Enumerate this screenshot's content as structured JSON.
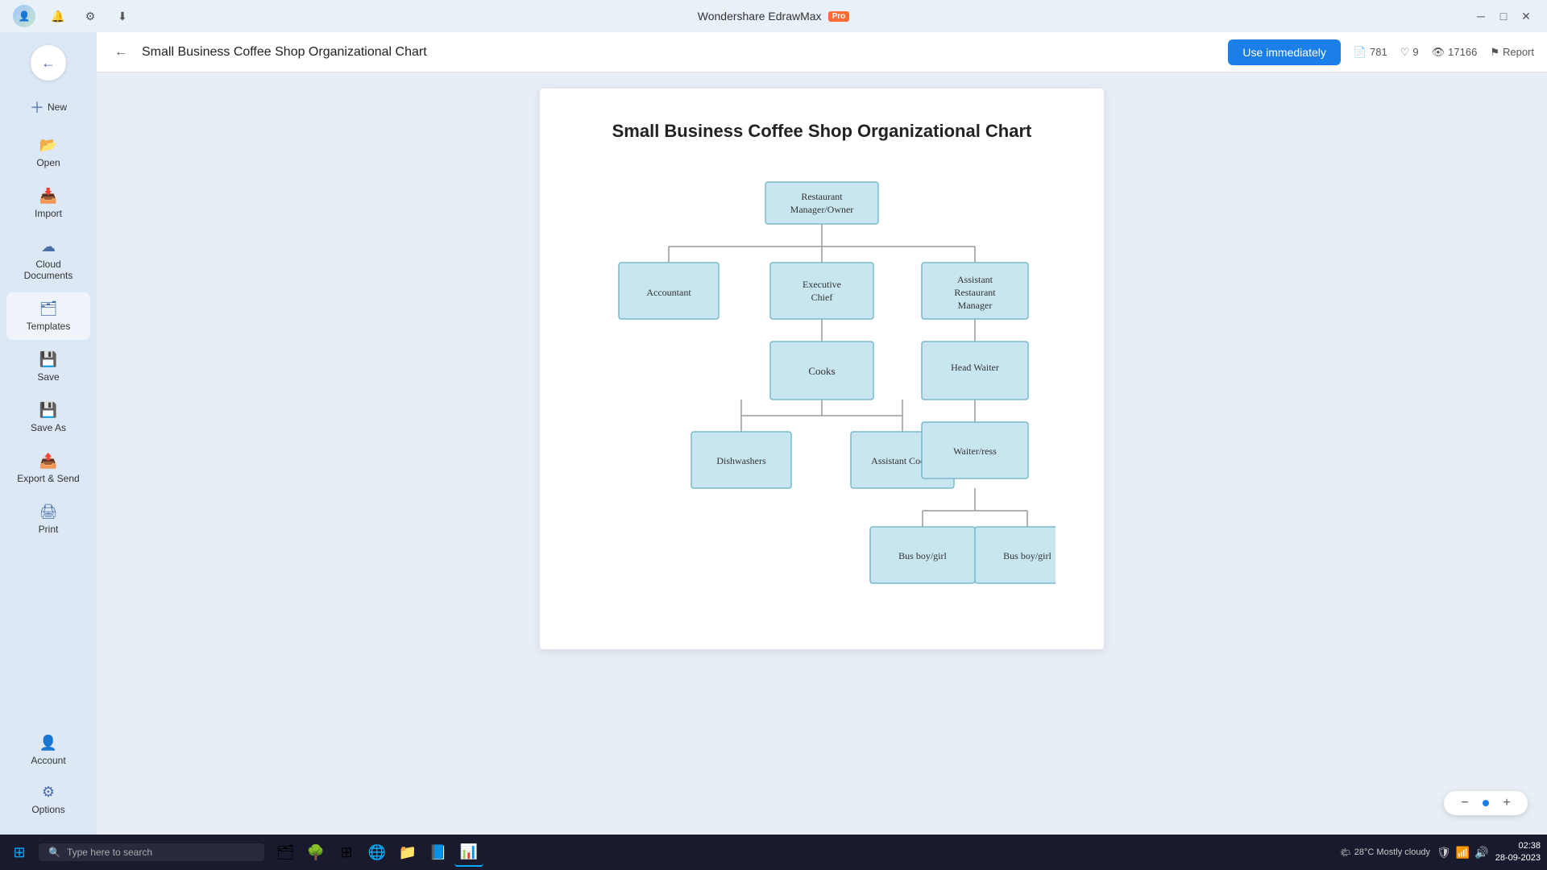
{
  "app": {
    "title": "Wondershare EdrawMax",
    "pro_badge": "Pro"
  },
  "window_controls": {
    "minimize": "─",
    "maximize": "□",
    "close": "✕"
  },
  "sidebar": {
    "items": [
      {
        "id": "new",
        "label": "New",
        "icon": "＋"
      },
      {
        "id": "open",
        "label": "Open",
        "icon": "📂"
      },
      {
        "id": "import",
        "label": "Import",
        "icon": "📥"
      },
      {
        "id": "cloud",
        "label": "Cloud Documents",
        "icon": "☁"
      },
      {
        "id": "templates",
        "label": "Templates",
        "icon": "🗂"
      },
      {
        "id": "save",
        "label": "Save",
        "icon": "💾"
      },
      {
        "id": "saveas",
        "label": "Save As",
        "icon": "💾"
      },
      {
        "id": "export",
        "label": "Export & Send",
        "icon": "📤"
      },
      {
        "id": "print",
        "label": "Print",
        "icon": "🖨"
      }
    ],
    "bottom_items": [
      {
        "id": "account",
        "label": "Account",
        "icon": "👤"
      },
      {
        "id": "options",
        "label": "Options",
        "icon": "⚙"
      }
    ]
  },
  "topbar": {
    "back_label": "←",
    "title": "Small Business Coffee Shop Organizational Chart",
    "use_immediately": "Use immediately",
    "stats": {
      "copies": "781",
      "likes": "9",
      "views": "17166"
    },
    "report_label": "Report"
  },
  "diagram": {
    "title": "Small Business Coffee Shop Organizational Chart",
    "nodes": {
      "root": "Restaurant\nManager/Owner",
      "level1": [
        "Accountant",
        "Executive Chief",
        "Assistant\nRestaurant\nManager"
      ],
      "level2_chief": [
        "Cooks"
      ],
      "level2_manager": [
        "Head Waiter"
      ],
      "level3_cooks": [
        "Dishwashers",
        "Assistant Cooks"
      ],
      "level3_waiter": [
        "Waiter/ress"
      ],
      "level4": [
        "Bus boy/girl",
        "Bus boy/girl"
      ]
    }
  },
  "zoom": {
    "minus": "−",
    "plus": "+"
  },
  "taskbar": {
    "search_placeholder": "Type here to search",
    "time": "02:38",
    "date": "28-09-2023",
    "weather": "28°C  Mostly cloudy"
  }
}
